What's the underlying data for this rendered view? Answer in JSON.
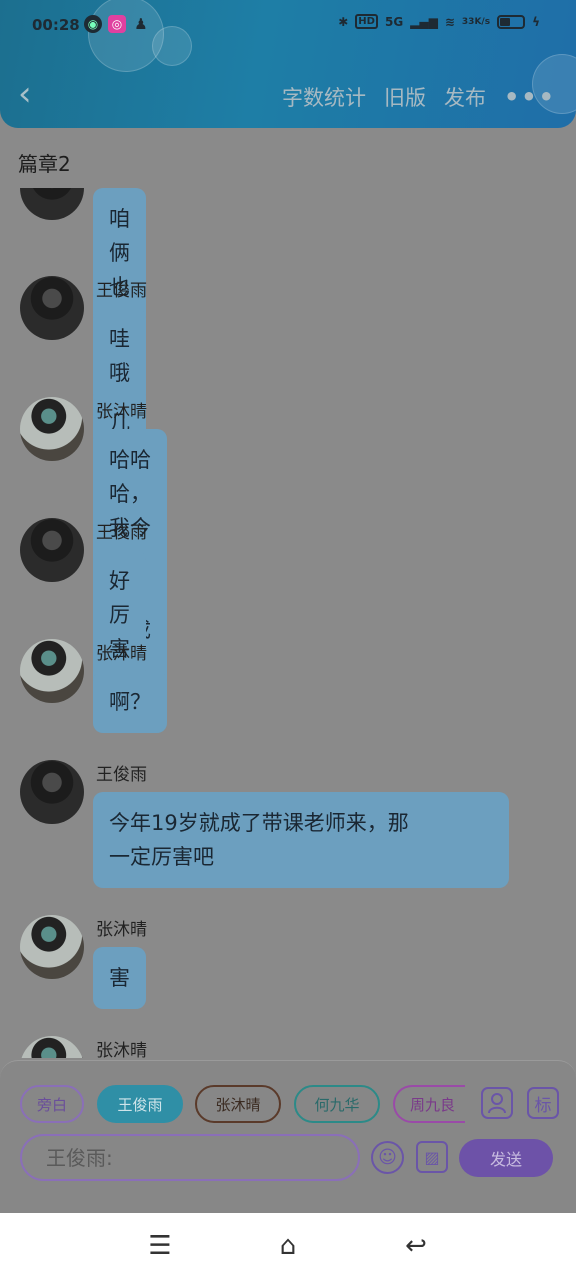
{
  "status_bar": {
    "time": "00:28",
    "network": "5G",
    "hd": "HD",
    "speed": "33K/s"
  },
  "header": {
    "back_label": "‹",
    "actions": [
      "字数统计",
      "旧版",
      "发布"
    ],
    "more_label": "•••"
  },
  "chapter": {
    "title": "篇章2"
  },
  "messages": [
    {
      "sender": "",
      "text": "咱俩也差不了几岁",
      "avatar": "dark"
    },
    {
      "sender": "王俊雨",
      "text": "哇哦",
      "avatar": "dark"
    },
    {
      "sender": "张沐晴",
      "text": "哈哈哈，我今年19刚成年",
      "avatar": "light"
    },
    {
      "sender": "王俊雨",
      "text": "好厉害",
      "avatar": "dark"
    },
    {
      "sender": "张沐晴",
      "text": "啊？",
      "avatar": "light"
    },
    {
      "sender": "王俊雨",
      "text": "今年19岁就成了带课老师来，那\n一定厉害吧",
      "avatar": "dark"
    },
    {
      "sender": "张沐晴",
      "text": "害",
      "avatar": "light"
    },
    {
      "sender": "张沐晴",
      "text": "",
      "avatar": "light"
    }
  ],
  "composer": {
    "chips": [
      "旁白",
      "王俊雨",
      "张沐晴",
      "何九华",
      "周九良"
    ],
    "selected_chip": "王俊雨",
    "person_icon": "person-icon",
    "tag_label": "标",
    "input_placeholder": "王俊雨:",
    "send_label": "发送"
  },
  "system_nav": {
    "menu": "☰",
    "home": "⌂",
    "back": "↩"
  },
  "colors": {
    "header": "#1e7ea6",
    "bubble": "#6c9fbf",
    "accent": "#6d52a8",
    "selected_chip": "#2f8fa6"
  }
}
